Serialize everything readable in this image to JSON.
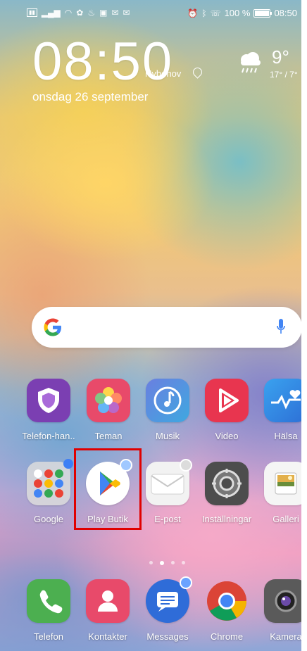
{
  "status_bar": {
    "left_icons": [
      "sim-icon",
      "signal-icon",
      "wifi-icon",
      "notification-icon",
      "notification-icon",
      "gallery-icon",
      "mail-icon",
      "mail-icon"
    ],
    "right_icons": [
      "alarm-icon",
      "bluetooth-icon",
      "call-icon"
    ],
    "battery": "100 %",
    "time": "08:50"
  },
  "clock_widget": {
    "time": "08:50",
    "location": "Nybohov",
    "date": "onsdag 26 september",
    "temperature": "9°",
    "temp_range": "17° / 7°"
  },
  "search": {
    "logo": "G",
    "mic_icon": "microphone-icon"
  },
  "apps_row1": [
    {
      "label": "Telefon-han..",
      "icon": "shield-icon",
      "color": "#7b3fb2"
    },
    {
      "label": "Teman",
      "icon": "flower-icon",
      "color": "#e84a6a"
    },
    {
      "label": "Musik",
      "icon": "music-note-icon",
      "color": "#5b72d9"
    },
    {
      "label": "Video",
      "icon": "play-icon",
      "color": "#e8354f"
    },
    {
      "label": "Hälsa",
      "icon": "heart-icon",
      "color": "#3d8ee0"
    }
  ],
  "apps_row2": [
    {
      "label": "Google",
      "icon": "folder-icon",
      "color": "#d9d9d9"
    },
    {
      "label": "Play Butik",
      "icon": "play-store-icon",
      "color": "#ffffff"
    },
    {
      "label": "E-post",
      "icon": "mail-icon",
      "color": "#f2f2f2"
    },
    {
      "label": "Inställningar",
      "icon": "gear-icon",
      "color": "#555555"
    },
    {
      "label": "Galleri",
      "icon": "gallery-icon",
      "color": "#f5f5f5"
    }
  ],
  "dock": [
    {
      "label": "Telefon",
      "icon": "phone-icon",
      "color": "#4caf50"
    },
    {
      "label": "Kontakter",
      "icon": "contact-icon",
      "color": "#e84a6a"
    },
    {
      "label": "Messages",
      "icon": "message-icon",
      "color": "#2f6cd8"
    },
    {
      "label": "Chrome",
      "icon": "chrome-icon",
      "color": "#ffffff"
    },
    {
      "label": "Kamera",
      "icon": "camera-icon",
      "color": "#555555"
    }
  ]
}
